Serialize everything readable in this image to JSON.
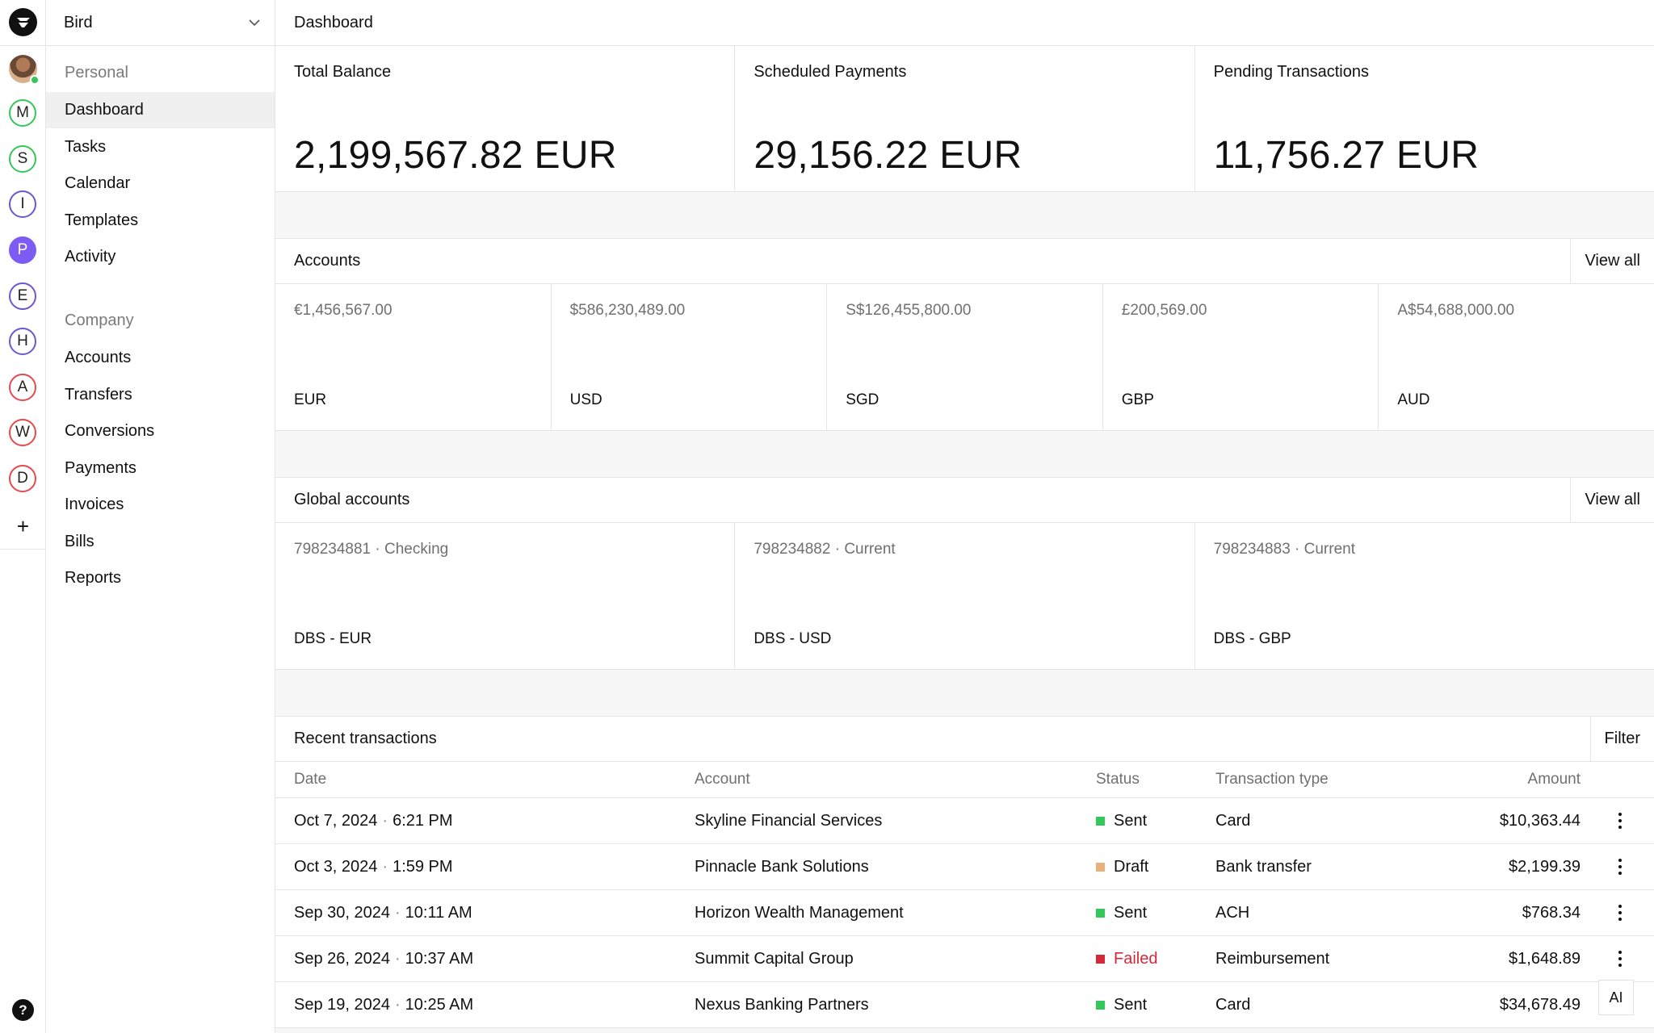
{
  "rail": {
    "workspaces": [
      {
        "letter": "M",
        "color": "#34c759",
        "filled": false
      },
      {
        "letter": "S",
        "color": "#34c759",
        "filled": false
      },
      {
        "letter": "I",
        "color": "#6e56cf",
        "filled": false
      },
      {
        "letter": "P",
        "color": "#7c5cf5",
        "filled": true
      },
      {
        "letter": "E",
        "color": "#6e56cf",
        "filled": false
      },
      {
        "letter": "H",
        "color": "#6e56cf",
        "filled": false
      },
      {
        "letter": "A",
        "color": "#e5484d",
        "filled": false
      },
      {
        "letter": "W",
        "color": "#e5484d",
        "filled": false
      },
      {
        "letter": "D",
        "color": "#e5484d",
        "filled": false
      }
    ],
    "add_label": "+",
    "help_label": "?"
  },
  "sidebar": {
    "org_name": "Bird",
    "personal_label": "Personal",
    "personal_items": [
      "Dashboard",
      "Tasks",
      "Calendar",
      "Templates",
      "Activity"
    ],
    "active_item": "Dashboard",
    "company_label": "Company",
    "company_items": [
      "Accounts",
      "Transfers",
      "Conversions",
      "Payments",
      "Invoices",
      "Bills",
      "Reports"
    ]
  },
  "header": {
    "title": "Dashboard"
  },
  "stats": [
    {
      "label": "Total Balance",
      "value": "2,199,567.82 EUR"
    },
    {
      "label": "Scheduled Payments",
      "value": "29,156.22 EUR"
    },
    {
      "label": "Pending Transactions",
      "value": "11,756.27 EUR"
    }
  ],
  "accounts": {
    "title": "Accounts",
    "action": "View all",
    "items": [
      {
        "balance": "€1,456,567.00",
        "currency": "EUR"
      },
      {
        "balance": "$586,230,489.00",
        "currency": "USD"
      },
      {
        "balance": "S$126,455,800.00",
        "currency": "SGD"
      },
      {
        "balance": "£200,569.00",
        "currency": "GBP"
      },
      {
        "balance": "A$54,688,000.00",
        "currency": "AUD"
      }
    ]
  },
  "global_accounts": {
    "title": "Global accounts",
    "action": "View all",
    "items": [
      {
        "number": "798234881 · Checking",
        "name": "DBS - EUR"
      },
      {
        "number": "798234882 · Current",
        "name": "DBS - USD"
      },
      {
        "number": "798234883 · Current",
        "name": "DBS - GBP"
      }
    ]
  },
  "transactions": {
    "title": "Recent transactions",
    "action": "Filter",
    "columns": {
      "date": "Date",
      "account": "Account",
      "status": "Status",
      "type": "Transaction type",
      "amount": "Amount"
    },
    "status_colors": {
      "Sent": "#34c759",
      "Draft": "#e8b07a",
      "Failed": "#d6283b"
    },
    "rows": [
      {
        "date": "Oct 7, 2024",
        "time": "6:21 PM",
        "account": "Skyline Financial Services",
        "status": "Sent",
        "type": "Card",
        "amount": "$10,363.44"
      },
      {
        "date": "Oct 3, 2024",
        "time": "1:59 PM",
        "account": "Pinnacle Bank Solutions",
        "status": "Draft",
        "type": "Bank transfer",
        "amount": "$2,199.39"
      },
      {
        "date": "Sep 30, 2024",
        "time": "10:11 AM",
        "account": "Horizon Wealth Management",
        "status": "Sent",
        "type": "ACH",
        "amount": "$768.34"
      },
      {
        "date": "Sep 26, 2024",
        "time": "10:37 AM",
        "account": "Summit Capital Group",
        "status": "Failed",
        "type": "Reimbursement",
        "amount": "$1,648.89"
      },
      {
        "date": "Sep 19, 2024",
        "time": "10:25 AM",
        "account": "Nexus Banking Partners",
        "status": "Sent",
        "type": "Card",
        "amount": "$34,678.49"
      }
    ]
  },
  "ai_button": {
    "label": "AI"
  }
}
